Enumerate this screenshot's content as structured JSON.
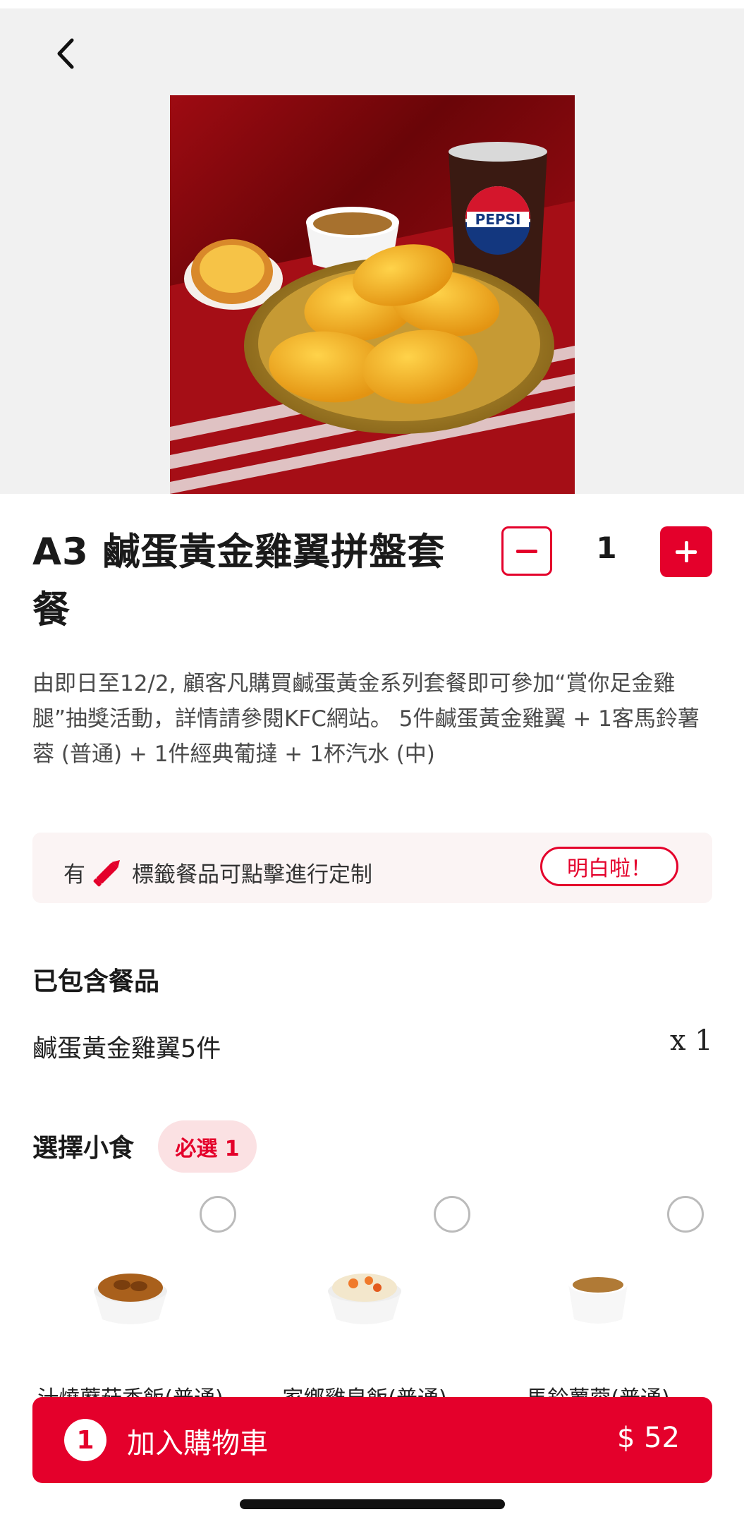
{
  "header": {
    "back_icon": "chevron-left-icon"
  },
  "product": {
    "title": "A3 鹹蛋黃金雞翼拼盤套餐",
    "description": "由即日至12/2, 顧客凡購買鹹蛋黃金系列套餐即可參加“賞你足金雞腿”抽獎活動，詳情請參閱KFC網站。 5件鹹蛋黃金雞翼 + 1客馬鈴薯蓉 (普通) + 1件經典葡撻 + 1杯汽水 (中)",
    "image_drink_label": "PEPSI"
  },
  "quantity": {
    "value": "1"
  },
  "tip": {
    "prefix": "有",
    "icon": "pencil-icon",
    "text": "標籤餐品可點擊進行定制",
    "button_label": "明白啦！"
  },
  "included": {
    "heading": "已包含餐品",
    "items": [
      {
        "name": "鹹蛋黃金雞翼5件",
        "qty": "x 1"
      }
    ]
  },
  "snacks": {
    "heading": "選擇小食",
    "badge": "必選 1",
    "options": [
      {
        "name": "汁燒蘑菇香飯(普通)"
      },
      {
        "name": "家鄉雞皇飯(普通)"
      },
      {
        "name": "馬鈴薯蓉(普通)"
      }
    ]
  },
  "cart": {
    "count": "1",
    "label": "加入購物車",
    "price": "$ 52"
  },
  "colors": {
    "brand_red": "#e4002b",
    "tip_bg": "#fbf4f4",
    "badge_bg": "#fbe1e3"
  }
}
